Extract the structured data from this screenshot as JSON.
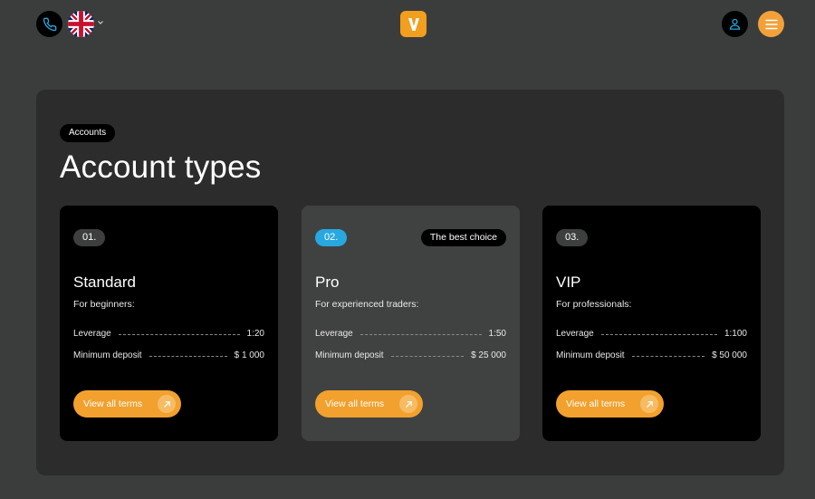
{
  "header": {
    "phone_icon": "phone-icon",
    "language_flag": "uk-flag-icon",
    "language_chevron": "chevron-down-icon",
    "logo_icon": "v-logo",
    "user_icon": "user-icon",
    "menu_icon": "menu-icon"
  },
  "section": {
    "badge": "Accounts",
    "title": "Account types"
  },
  "cards": [
    {
      "number": "01.",
      "title": "Standard",
      "subtitle": "For beginners:",
      "leverage_label": "Leverage",
      "leverage_value": "1:20",
      "deposit_label": "Minimum deposit",
      "deposit_value": "$ 1 000",
      "button_label": "View all terms"
    },
    {
      "number": "02.",
      "badge": "The best choice",
      "title": "Pro",
      "subtitle": "For experienced traders:",
      "leverage_label": "Leverage",
      "leverage_value": "1:50",
      "deposit_label": "Minimum deposit",
      "deposit_value": "$ 25 000",
      "button_label": "View all terms"
    },
    {
      "number": "03.",
      "title": "VIP",
      "subtitle": "For professionals:",
      "leverage_label": "Leverage",
      "leverage_value": "1:100",
      "deposit_label": "Minimum deposit",
      "deposit_value": "$ 50 000",
      "button_label": "View all terms"
    }
  ],
  "colors": {
    "background": "#3b3d3c",
    "panel": "#2c2c2c",
    "accent_orange": "#f2a12e",
    "accent_blue": "#28a8e0"
  }
}
